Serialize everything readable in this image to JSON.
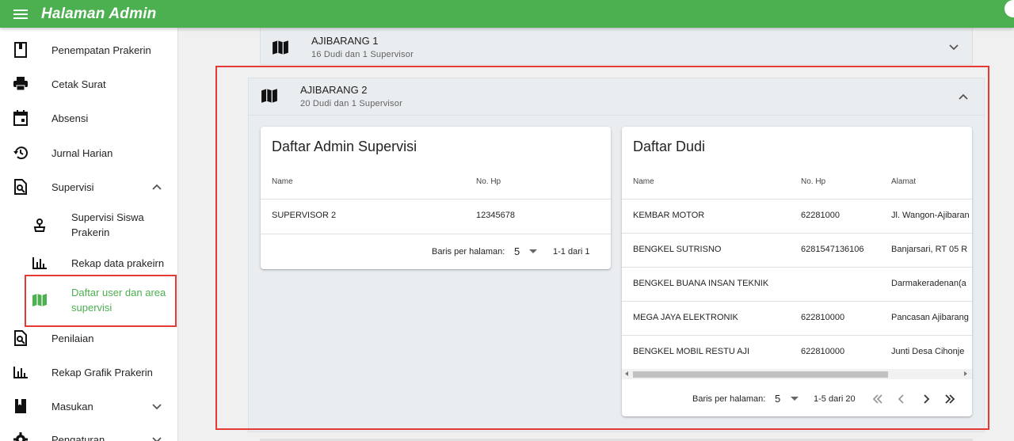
{
  "app": {
    "title": "Halaman Admin"
  },
  "sidebar": {
    "items": [
      {
        "label": "Penempatan Prakerin",
        "icon": "book-icon"
      },
      {
        "label": "Cetak Surat",
        "icon": "printer-icon"
      },
      {
        "label": "Absensi",
        "icon": "calendar-icon"
      },
      {
        "label": "Jurnal Harian",
        "icon": "history-icon"
      },
      {
        "label": "Supervisi",
        "icon": "search-document-icon"
      },
      {
        "label": "Supervisi Siswa Prakerin",
        "icon": "person-pin-icon"
      },
      {
        "label": "Rekap data prakeirn",
        "icon": "bar-chart-icon"
      },
      {
        "label": "Daftar user dan area supervisi",
        "icon": "map-icon"
      },
      {
        "label": "Penilaian",
        "icon": "search-document-icon"
      },
      {
        "label": "Rekap Grafik Prakerin",
        "icon": "bar-chart-icon"
      },
      {
        "label": "Masukan",
        "icon": "bookmark-icon"
      },
      {
        "label": "Pengaturan",
        "icon": "gear-icon"
      }
    ],
    "active_color": "#4caf50"
  },
  "areas": [
    {
      "title": "AJIBARANG 1",
      "subtitle": "16 Dudi dan 1 Supervisor"
    },
    {
      "title": "AJIBARANG 2",
      "subtitle": "20 Dudi dan 1 Supervisor"
    }
  ],
  "admin_card": {
    "title": "Daftar Admin Supervisi",
    "headers": [
      "Name",
      "No. Hp"
    ],
    "rows": [
      [
        "SUPERVISOR 2",
        "12345678"
      ]
    ],
    "rows_per_page_label": "Baris per halaman:",
    "rows_per_page": "5",
    "range": "1-1 dari 1"
  },
  "dudi_card": {
    "title": "Daftar Dudi",
    "headers": [
      "Name",
      "No. Hp",
      "Alamat"
    ],
    "rows": [
      [
        "KEMBAR MOTOR",
        "62281000",
        "Jl. Wangon-Ajibaran"
      ],
      [
        "BENGKEL SUTRISNO",
        "6281547136106",
        "Banjarsari, RT 05 R"
      ],
      [
        "BENGKEL BUANA INSAN TEKNIK",
        "",
        "Darmakeradenan(a"
      ],
      [
        "MEGA JAYA ELEKTRONIK",
        "622810000",
        "Pancasan Ajibarang"
      ],
      [
        "BENGKEL MOBIL RESTU AJI",
        "622810000",
        "Junti Desa Cihonje"
      ]
    ],
    "rows_per_page_label": "Baris per halaman:",
    "rows_per_page": "5",
    "range": "1-5 dari 20"
  },
  "colors": {
    "appbar": "#4caf50",
    "highlight": "#e53935"
  }
}
